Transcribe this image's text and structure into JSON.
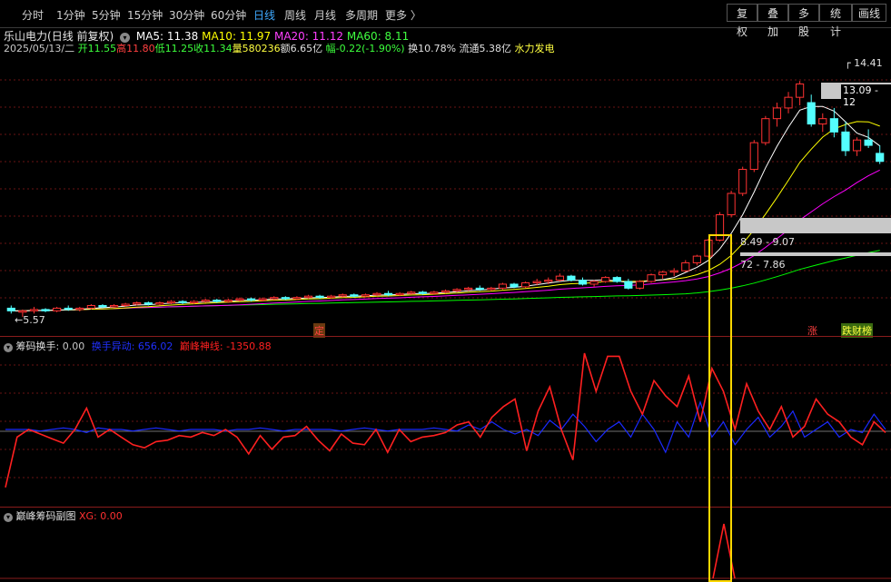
{
  "toolbar": {
    "periods": [
      "分时",
      "1分钟",
      "5分钟",
      "15分钟",
      "30分钟",
      "60分钟",
      "日线",
      "周线",
      "月线",
      "多周期",
      "更多 〉"
    ],
    "active": "日线",
    "buttons": [
      "复权",
      "叠加",
      "多股",
      "统计",
      "画线"
    ]
  },
  "header": {
    "stock_name": "乐山电力",
    "mode": "(日线 前复权)",
    "ma5": "MA5: 11.38",
    "ma10": "MA10: 11.97",
    "ma20": "MA20: 11.12",
    "ma60": "MA60: 8.11",
    "date": "2025/05/13/二",
    "open": "开11.55",
    "high": "高11.80",
    "low": "低11.25",
    "close": "收11.34",
    "volume": "量580236",
    "amount": "额6.65亿",
    "change": "幅-0.22(-1.90%)",
    "turnover": "换10.78%",
    "float": "流通5.38亿",
    "sector": "水力发电"
  },
  "main_chart": {
    "high_label": "14.41",
    "low_label": "5.57",
    "range1": "13.09 - 12",
    "range2": "8.49 - 9.07",
    "range3": "72 - 7.86",
    "marker_ding": "定",
    "marker_zhang": "涨",
    "marker_diecai": "跌财榜"
  },
  "panel2": {
    "title": "筹码换手",
    "value": ": 0.00",
    "line1": "换手异动: 656.02",
    "line2": "巅峰神线: -1350.88"
  },
  "panel3": {
    "title": "巅峰筹码副图",
    "value": "XG: 0.00"
  },
  "colors": {
    "up": "#ff3232",
    "down": "#54ffff",
    "ma5": "#ffffff",
    "ma10": "#ffff00",
    "ma20": "#ff00ff",
    "ma60": "#00ff00",
    "highlight": "#ffd700"
  },
  "chart_data": {
    "type": "candlestick",
    "ylim": [
      5.2,
      15.2
    ],
    "candles_ohlc": [
      [
        5.9,
        6.0,
        5.7,
        5.8
      ],
      [
        5.75,
        5.85,
        5.57,
        5.8
      ],
      [
        5.8,
        5.95,
        5.7,
        5.85
      ],
      [
        5.85,
        5.9,
        5.75,
        5.8
      ],
      [
        5.8,
        5.95,
        5.75,
        5.9
      ],
      [
        5.9,
        6.0,
        5.8,
        5.85
      ],
      [
        5.85,
        5.95,
        5.78,
        5.9
      ],
      [
        5.9,
        6.05,
        5.85,
        6.0
      ],
      [
        6.0,
        6.05,
        5.9,
        5.95
      ],
      [
        5.95,
        6.05,
        5.9,
        6.0
      ],
      [
        6.0,
        6.1,
        5.95,
        6.05
      ],
      [
        6.05,
        6.15,
        6.0,
        6.1
      ],
      [
        6.1,
        6.15,
        6.0,
        6.05
      ],
      [
        6.05,
        6.15,
        6.0,
        6.1
      ],
      [
        6.1,
        6.2,
        6.05,
        6.15
      ],
      [
        6.15,
        6.2,
        6.05,
        6.1
      ],
      [
        6.1,
        6.2,
        6.05,
        6.15
      ],
      [
        6.15,
        6.25,
        6.1,
        6.2
      ],
      [
        6.2,
        6.25,
        6.1,
        6.15
      ],
      [
        6.15,
        6.25,
        6.1,
        6.2
      ],
      [
        6.2,
        6.3,
        6.15,
        6.25
      ],
      [
        6.25,
        6.3,
        6.15,
        6.2
      ],
      [
        6.2,
        6.3,
        6.15,
        6.25
      ],
      [
        6.25,
        6.35,
        6.2,
        6.3
      ],
      [
        6.3,
        6.35,
        6.2,
        6.25
      ],
      [
        6.25,
        6.35,
        6.2,
        6.3
      ],
      [
        6.3,
        6.4,
        6.25,
        6.35
      ],
      [
        6.35,
        6.4,
        6.25,
        6.3
      ],
      [
        6.3,
        6.4,
        6.25,
        6.35
      ],
      [
        6.35,
        6.45,
        6.3,
        6.4
      ],
      [
        6.4,
        6.45,
        6.3,
        6.35
      ],
      [
        6.35,
        6.45,
        6.3,
        6.4
      ],
      [
        6.4,
        6.5,
        6.35,
        6.45
      ],
      [
        6.45,
        6.55,
        6.35,
        6.4
      ],
      [
        6.4,
        6.5,
        6.35,
        6.45
      ],
      [
        6.45,
        6.55,
        6.4,
        6.5
      ],
      [
        6.5,
        6.55,
        6.4,
        6.45
      ],
      [
        6.45,
        6.55,
        6.4,
        6.5
      ],
      [
        6.5,
        6.6,
        6.45,
        6.55
      ],
      [
        6.55,
        6.65,
        6.5,
        6.6
      ],
      [
        6.6,
        6.7,
        6.55,
        6.65
      ],
      [
        6.65,
        6.75,
        6.55,
        6.6
      ],
      [
        6.6,
        6.7,
        6.55,
        6.65
      ],
      [
        6.65,
        6.85,
        6.6,
        6.8
      ],
      [
        6.8,
        6.85,
        6.65,
        6.7
      ],
      [
        6.7,
        6.9,
        6.65,
        6.85
      ],
      [
        6.85,
        7.0,
        6.75,
        6.9
      ],
      [
        6.9,
        7.05,
        6.8,
        6.95
      ],
      [
        6.95,
        7.2,
        6.9,
        7.1
      ],
      [
        7.1,
        7.15,
        6.9,
        6.95
      ],
      [
        6.95,
        7.05,
        6.75,
        6.8
      ],
      [
        6.8,
        6.95,
        6.7,
        6.9
      ],
      [
        6.9,
        7.1,
        6.85,
        7.05
      ],
      [
        7.05,
        7.1,
        6.85,
        6.9
      ],
      [
        6.9,
        7.0,
        6.6,
        6.65
      ],
      [
        6.65,
        6.95,
        6.6,
        6.9
      ],
      [
        6.9,
        7.2,
        6.85,
        7.15
      ],
      [
        7.15,
        7.3,
        7.0,
        7.25
      ],
      [
        7.25,
        7.4,
        7.1,
        7.3
      ],
      [
        7.3,
        7.7,
        7.25,
        7.6
      ],
      [
        7.6,
        7.9,
        7.5,
        7.85
      ],
      [
        7.85,
        8.5,
        7.8,
        8.45
      ],
      [
        8.45,
        9.5,
        8.4,
        9.4
      ],
      [
        9.4,
        10.3,
        9.3,
        10.2
      ],
      [
        10.2,
        11.2,
        10.1,
        11.1
      ],
      [
        11.1,
        12.2,
        11.0,
        12.1
      ],
      [
        12.1,
        13.1,
        12.0,
        13.0
      ],
      [
        13.0,
        13.6,
        12.7,
        13.4
      ],
      [
        13.4,
        14.0,
        13.2,
        13.8
      ],
      [
        13.8,
        14.41,
        13.5,
        14.3
      ],
      [
        13.6,
        13.9,
        12.7,
        12.8
      ],
      [
        12.8,
        13.2,
        12.5,
        13.0
      ],
      [
        13.0,
        13.4,
        12.3,
        12.5
      ],
      [
        12.5,
        12.9,
        11.6,
        11.8
      ],
      [
        11.8,
        12.3,
        11.6,
        12.2
      ],
      [
        12.2,
        12.6,
        11.9,
        12.0
      ],
      [
        11.7,
        12.0,
        11.3,
        11.4
      ]
    ],
    "osc_red": [
      0.12,
      0.45,
      0.5,
      0.47,
      0.44,
      0.41,
      0.5,
      0.64,
      0.45,
      0.5,
      0.45,
      0.4,
      0.38,
      0.42,
      0.43,
      0.46,
      0.45,
      0.48,
      0.46,
      0.5,
      0.45,
      0.34,
      0.46,
      0.37,
      0.45,
      0.46,
      0.52,
      0.43,
      0.36,
      0.47,
      0.41,
      0.4,
      0.5,
      0.35,
      0.5,
      0.42,
      0.45,
      0.46,
      0.48,
      0.53,
      0.55,
      0.45,
      0.58,
      0.65,
      0.7,
      0.36,
      0.62,
      0.78,
      0.5,
      0.3,
      1.0,
      0.75,
      0.98,
      0.98,
      0.75,
      0.6,
      0.82,
      0.72,
      0.65,
      0.85,
      0.55,
      0.9,
      0.75,
      0.5,
      0.8,
      0.62,
      0.5,
      0.65,
      0.45,
      0.52,
      0.7,
      0.6,
      0.55,
      0.45,
      0.4,
      0.55,
      0.48
    ],
    "osc_blue": [
      0.5,
      0.5,
      0.5,
      0.49,
      0.5,
      0.51,
      0.5,
      0.48,
      0.51,
      0.5,
      0.5,
      0.49,
      0.5,
      0.51,
      0.5,
      0.49,
      0.5,
      0.5,
      0.5,
      0.49,
      0.5,
      0.5,
      0.51,
      0.5,
      0.49,
      0.5,
      0.5,
      0.5,
      0.5,
      0.49,
      0.5,
      0.51,
      0.5,
      0.49,
      0.5,
      0.5,
      0.5,
      0.51,
      0.5,
      0.49,
      0.53,
      0.5,
      0.55,
      0.5,
      0.47,
      0.5,
      0.46,
      0.56,
      0.5,
      0.6,
      0.52,
      0.42,
      0.5,
      0.55,
      0.45,
      0.6,
      0.5,
      0.35,
      0.55,
      0.45,
      0.68,
      0.45,
      0.55,
      0.4,
      0.5,
      0.58,
      0.45,
      0.52,
      0.62,
      0.45,
      0.5,
      0.55,
      0.45,
      0.5,
      0.48,
      0.6,
      0.5
    ]
  }
}
